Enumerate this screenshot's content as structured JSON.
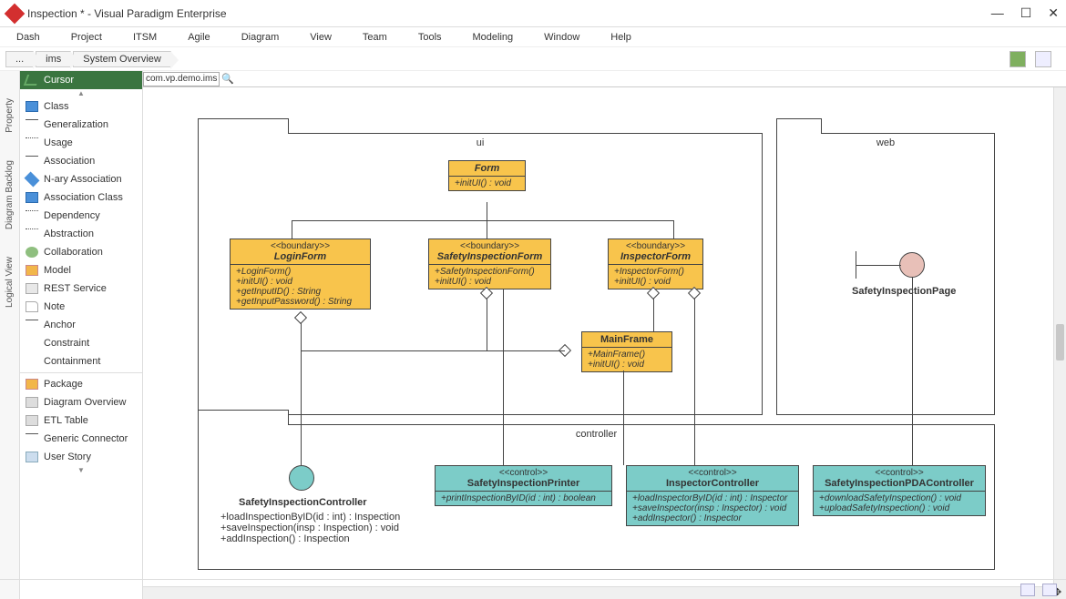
{
  "window": {
    "title": "Inspection * - Visual Paradigm Enterprise"
  },
  "menu": {
    "items": [
      "Dash",
      "Project",
      "ITSM",
      "Agile",
      "Diagram",
      "View",
      "Team",
      "Tools",
      "Modeling",
      "Window",
      "Help"
    ]
  },
  "breadcrumb": {
    "root": "...",
    "mid": "ims",
    "leaf": "System Overview"
  },
  "address": {
    "value": "com.vp.demo.ims"
  },
  "dock": {
    "tabs": [
      "Property",
      "Diagram Backlog",
      "Logical View"
    ]
  },
  "palette": {
    "cursor": "Cursor",
    "items": [
      "Class",
      "Generalization",
      "Usage",
      "Association",
      "N-ary Association",
      "Association Class",
      "Dependency",
      "Abstraction",
      "Collaboration",
      "Model",
      "REST Service",
      "Note",
      "Anchor",
      "Constraint",
      "Containment"
    ],
    "items2": [
      "Package",
      "Diagram Overview",
      "ETL Table",
      "Generic Connector",
      "User Story"
    ]
  },
  "packages": {
    "ui": "ui",
    "web": "web",
    "controller": "controller"
  },
  "classes": {
    "form": {
      "name": "Form",
      "ops": [
        "+initUI() : void"
      ]
    },
    "login": {
      "stereo": "<<boundary>>",
      "name": "LoginForm",
      "ops": [
        "+LoginForm()",
        "+initUI() : void",
        "+getInputID() : String",
        "+getInputPassword() : String"
      ]
    },
    "sif": {
      "stereo": "<<boundary>>",
      "name": "SafetyInspectionForm",
      "ops": [
        "+SafetyInspectionForm()",
        "+initUI() : void"
      ]
    },
    "insp": {
      "stereo": "<<boundary>>",
      "name": "InspectorForm",
      "ops": [
        "+InspectorForm()",
        "+initUI() : void"
      ]
    },
    "main": {
      "name": "MainFrame",
      "ops": [
        "+MainFrame()",
        "+initUI() : void"
      ]
    },
    "sip": {
      "name": "SafetyInspectionPage"
    },
    "sic": {
      "name": "SafetyInspectionController",
      "ops": [
        "+loadInspectionByID(id : int) : Inspection",
        "+saveInspection(insp : Inspection) : void",
        "+addInspection() : Inspection"
      ]
    },
    "printer": {
      "stereo": "<<control>>",
      "name": "SafetyInspectionPrinter",
      "ops": [
        "+printInspectionByID(id : int) : boolean"
      ]
    },
    "ictrl": {
      "stereo": "<<control>>",
      "name": "InspectorController",
      "ops": [
        "+loadInspectorByID(id : int) : Inspector",
        "+saveInspector(insp : Inspector) : void",
        "+addInspector() : Inspector"
      ]
    },
    "pda": {
      "stereo": "<<control>>",
      "name": "SafetyInspectionPDAController",
      "ops": [
        "+downloadSafetyInspection() : void",
        "+uploadSafetyInspection() : void"
      ]
    }
  }
}
